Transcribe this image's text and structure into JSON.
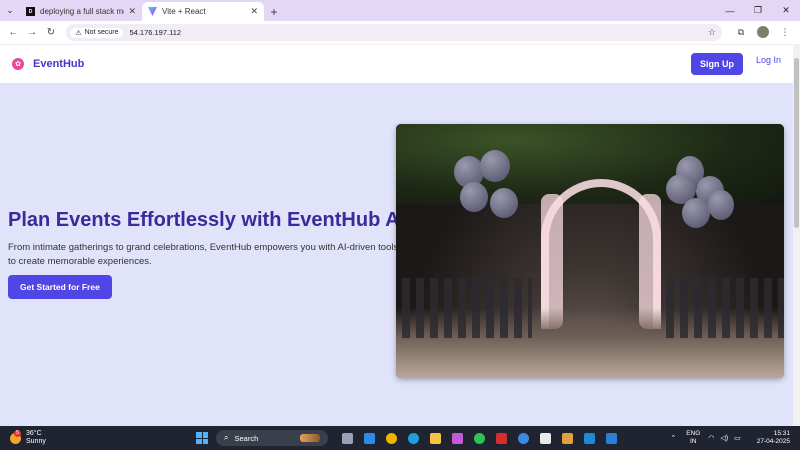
{
  "browser": {
    "tabs": [
      {
        "title": "deploying a full stack mern app",
        "favicon": "dev-icon",
        "active": false
      },
      {
        "title": "Vite + React",
        "favicon": "vite-icon",
        "active": true
      }
    ],
    "address": {
      "security_label": "Not secure",
      "url": "54.176.197.112"
    }
  },
  "app": {
    "brand": "EventHub",
    "nav": {
      "signup_label": "Sign Up",
      "login_label": "Log In"
    },
    "hero": {
      "title": "Plan Events Effortlessly with EventHub AI",
      "subtitle": "From intimate gatherings to grand celebrations, EventHub empowers you with AI-driven tools to create memorable experiences.",
      "cta_label": "Get Started for Free"
    },
    "colors": {
      "accent": "#4f46e5",
      "brand_text": "#4338ca",
      "hero_title": "#3b2a9a",
      "page_bg": "#e1e3fb"
    }
  },
  "taskbar": {
    "weather": {
      "temp": "36°C",
      "condition": "Sunny",
      "badge": "5"
    },
    "search_label": "Search",
    "lang": {
      "line1": "ENG",
      "line2": "IN"
    },
    "clock": {
      "time": "15:31",
      "date": "27-04-2025"
    }
  }
}
